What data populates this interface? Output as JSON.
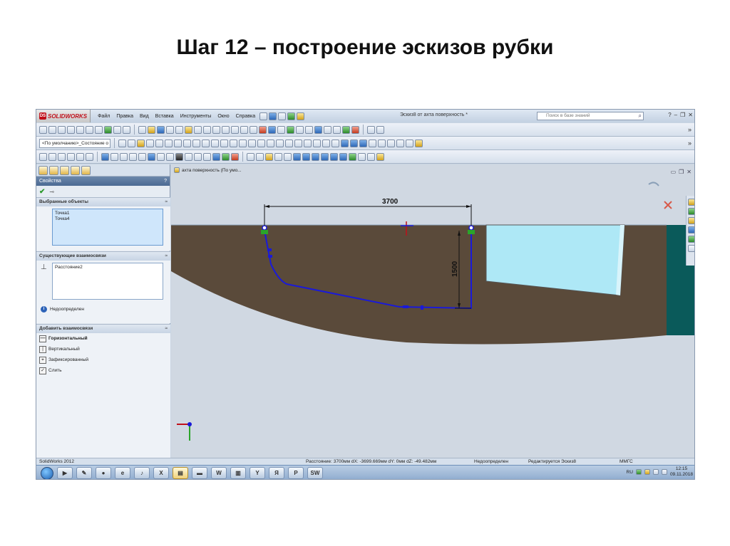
{
  "slide": {
    "title": "Шаг 12 – построение эскизов рубки"
  },
  "app": {
    "logo_text": "SOLIDWORKS",
    "menu": [
      "Файл",
      "Правка",
      "Вид",
      "Вставка",
      "Инструменты",
      "Окно",
      "Справка"
    ],
    "document_title": "Эскиз8 от ахта поверхность *",
    "search_placeholder": "Поиск в базе знаний",
    "configuration": "<По умолчанию>_Состояние о"
  },
  "property_manager": {
    "header": "Свойства",
    "help": "?",
    "selected_objects": {
      "title": "Выбранные объекты",
      "items": [
        "Точка1",
        "Точка4"
      ]
    },
    "existing_relations": {
      "title": "Существующие взаимосвязи",
      "items": [
        "Расстояние2"
      ],
      "status": "Недоопределен"
    },
    "add_relations": {
      "title": "Добавить взаимосвязи",
      "items": [
        "Горизонтальный",
        "Вертикальный",
        "Зафиксированный",
        "Слить"
      ]
    }
  },
  "graphics": {
    "tree_label": "ахта поверхность  (По умо...",
    "dimension_horizontal": "3700",
    "dimension_vertical": "1500"
  },
  "status_bar": {
    "app_version": "SolidWorks 2012",
    "distance_info": "Расстояние: 3700мм   dX: -3699.669мм  dY: 0мм  dZ: -49.482мм",
    "state": "Недоопределен",
    "editing": "Редактируется Эскиз8",
    "units": "ММГС"
  },
  "taskbar": {
    "language": "RU",
    "time": "12:15",
    "date": "09.11.2018"
  },
  "colors": {
    "hull_fill": "#5a4a3a",
    "teal_side": "#0a5a5a",
    "window_fill": "#aee8f6",
    "sketch_line": "#1a1ad8",
    "dim_line": "#111111"
  }
}
